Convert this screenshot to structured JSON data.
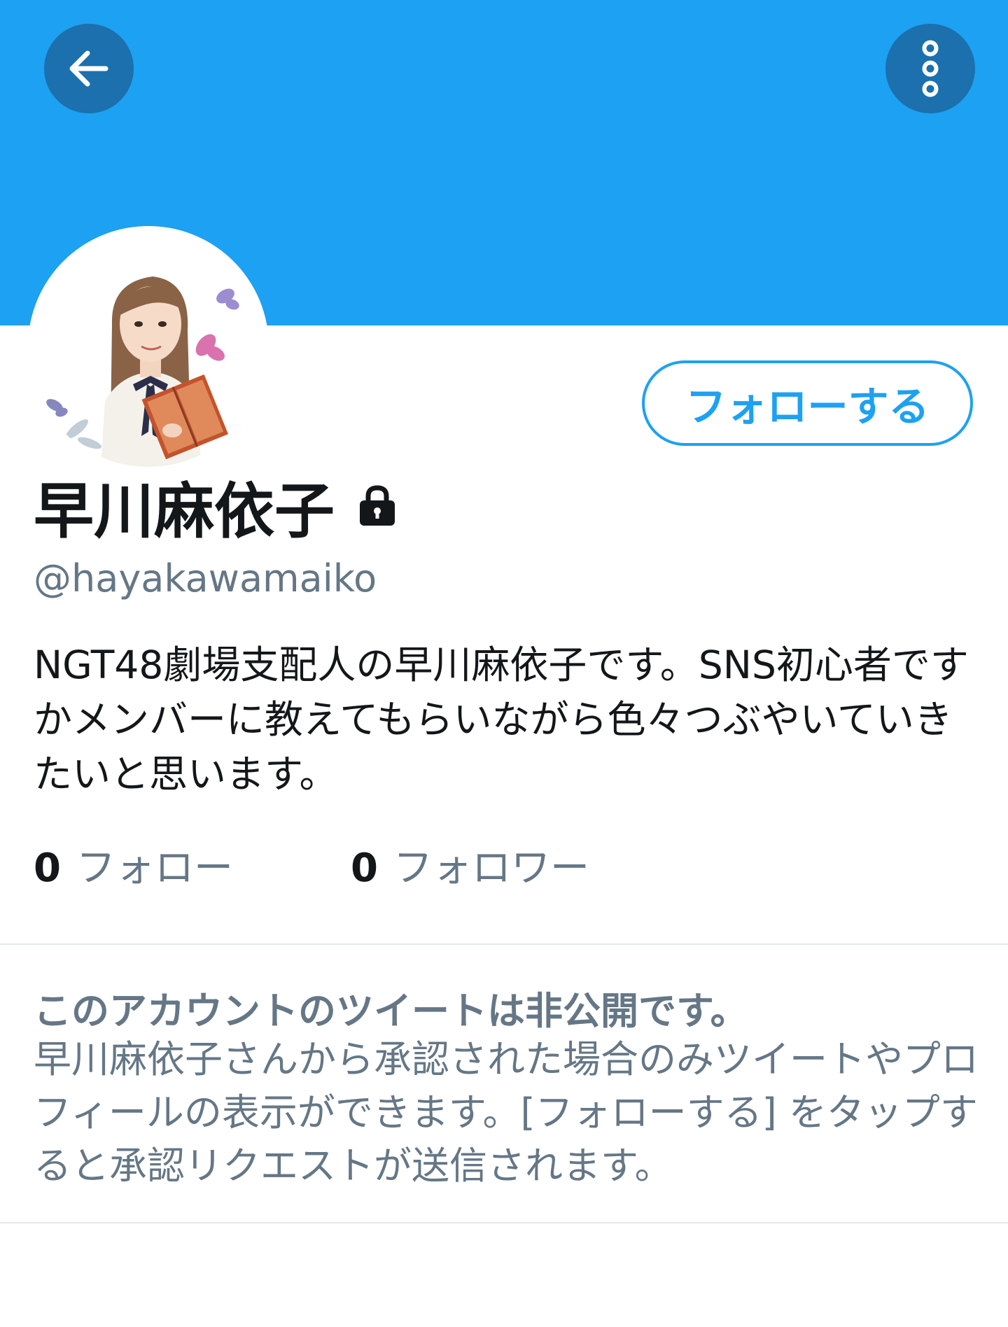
{
  "header": {
    "back_icon": "arrow-left-icon",
    "more_icon": "vertical-dots-icon",
    "banner_color": "#1da1f2",
    "button_color": "#1b70ad"
  },
  "profile": {
    "display_name": "早川麻依子",
    "protected_icon": "lock-icon",
    "handle": "@hayakawamaiko",
    "bio": "NGT48劇場支配人の早川麻依子です。SNS初心者ですかメンバーに教えてもらいながら色々つぶやいていきたいと思います。",
    "follow_button_label": "フォローする"
  },
  "stats": {
    "following_count": "0",
    "following_label": "フォロー",
    "followers_count": "0",
    "followers_label": "フォロワー"
  },
  "protected_notice": {
    "title": "このアカウントのツイートは非公開です。",
    "description": "早川麻依子さんから承認された場合のみツイートやプロフィールの表示ができます。[フォローする] をタップすると承認リクエストが送信されます。"
  },
  "colors": {
    "accent": "#1da1f2",
    "secondary_text": "#657786",
    "primary_text": "#14171a"
  }
}
